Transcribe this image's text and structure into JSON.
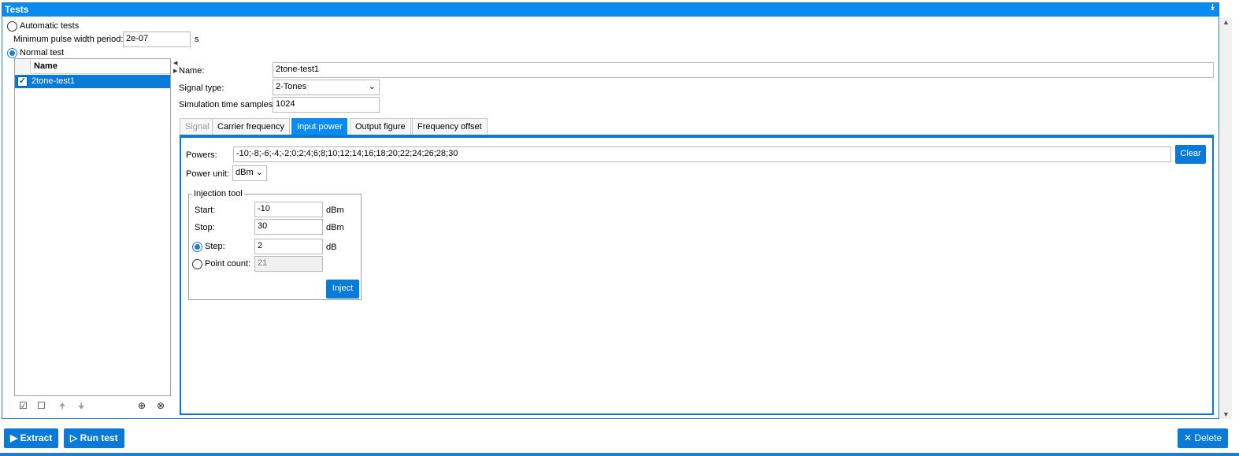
{
  "panel": {
    "title": "Tests"
  },
  "modes": {
    "automatic_label": "Automatic tests",
    "normal_label": "Normal test",
    "selected": "normal"
  },
  "min_pulse": {
    "label": "Minimum pulse width period:",
    "value": "2e-07",
    "unit": "s"
  },
  "test_list": {
    "header": "Name",
    "rows": [
      {
        "name": "2tone-test1",
        "checked": true,
        "selected": true
      }
    ]
  },
  "form": {
    "name_label": "Name:",
    "name_value": "2tone-test1",
    "signal_type_label": "Signal type:",
    "signal_type_value": "2-Tones",
    "sim_samples_label": "Simulation time samples:",
    "sim_samples_value": "1024"
  },
  "tabs": [
    {
      "label": "Signal",
      "state": "disabled"
    },
    {
      "label": "Carrier frequency",
      "state": "normal"
    },
    {
      "label": "Input power",
      "state": "active"
    },
    {
      "label": "Output figure",
      "state": "normal"
    },
    {
      "label": "Frequency offset",
      "state": "normal"
    }
  ],
  "input_power": {
    "powers_label": "Powers:",
    "powers_value": "-10;-8;-6;-4;-2;0;2;4;6;8;10;12;14;16;18;20;22;24;26;28;30",
    "clear_label": "Clear",
    "power_unit_label": "Power unit:",
    "power_unit_value": "dBm"
  },
  "injection_tool": {
    "title": "Injection tool",
    "start_label": "Start:",
    "start_value": "-10",
    "start_unit": "dBm",
    "stop_label": "Stop:",
    "stop_value": "30",
    "stop_unit": "dBm",
    "step_label": "Step:",
    "step_value": "2",
    "step_unit": "dB",
    "point_count_label": "Point count:",
    "point_count_value": "21",
    "mode_selected": "step",
    "inject_label": "Inject"
  },
  "footer": {
    "extract_label": "Extract",
    "run_label": "Run test",
    "delete_label": "Delete"
  },
  "colors": {
    "accent": "#0a8bf2",
    "button": "#0a7ad8"
  }
}
